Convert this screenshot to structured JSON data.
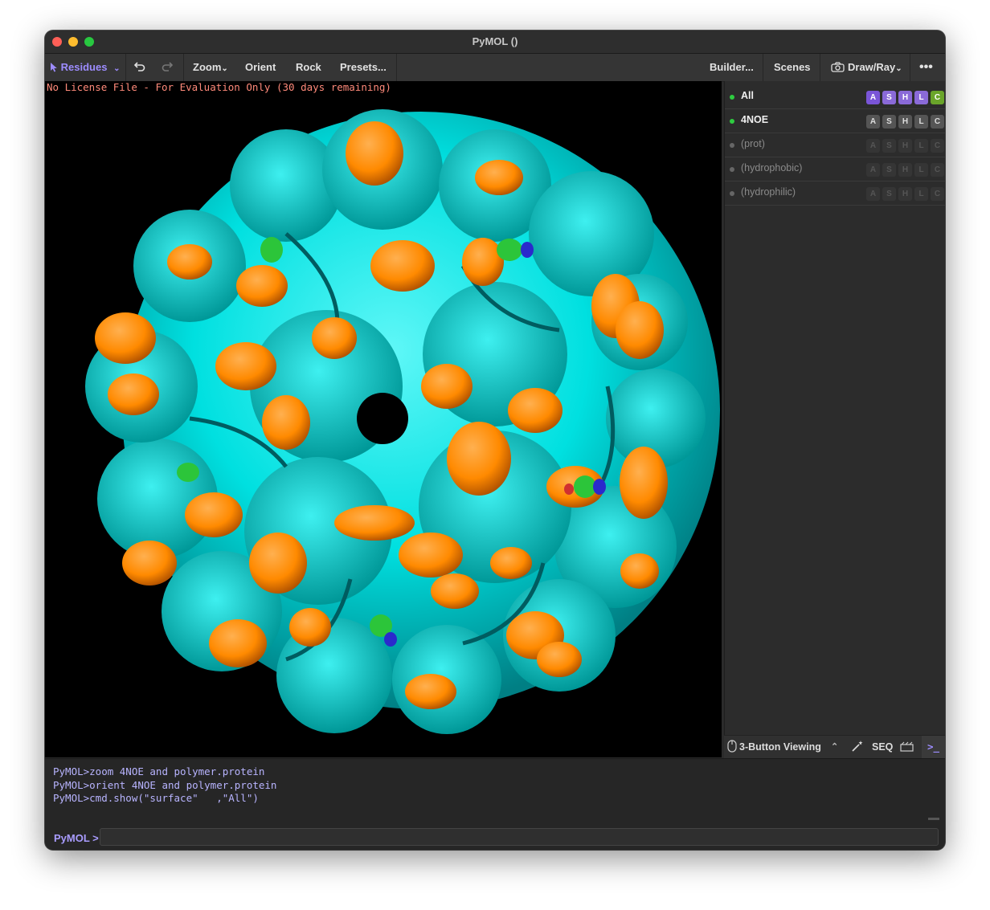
{
  "window": {
    "title": "PyMOL ()"
  },
  "toolbar": {
    "mouse_mode": "Residues",
    "undo_icon": "undo-icon",
    "redo_icon": "redo-icon",
    "zoom": "Zoom",
    "orient": "Orient",
    "rock": "Rock",
    "presets": "Presets...",
    "builder": "Builder...",
    "scenes": "Scenes",
    "draw_ray": "Draw/Ray",
    "more_icon": "ellipsis-icon"
  },
  "viewport": {
    "license_notice": "No License File - For Evaluation Only (30 days remaining)"
  },
  "objects": [
    {
      "name": "All",
      "enabled": true
    },
    {
      "name": "4NOE",
      "enabled": true
    },
    {
      "name": "(prot)",
      "enabled": false
    },
    {
      "name": "(hydrophobic)",
      "enabled": false
    },
    {
      "name": "(hydrophilic)",
      "enabled": false
    }
  ],
  "action_buttons": [
    "A",
    "S",
    "H",
    "L",
    "C"
  ],
  "bottom_bar": {
    "viewing_mode": "3-Button Viewing",
    "seq": "SEQ"
  },
  "console": {
    "log": [
      "PyMOL>zoom 4NOE and polymer.protein",
      "PyMOL>orient 4NOE and polymer.protein",
      "PyMOL>cmd.show(\"surface\"   ,\"All\")"
    ],
    "prompt": "PyMOL >",
    "input_value": ""
  },
  "colors": {
    "surface_hydrophilic": "#00e5e5",
    "surface_hydrophobic": "#ff8a00",
    "accent": "#9d8cff",
    "viewport_bg": "#000000"
  }
}
